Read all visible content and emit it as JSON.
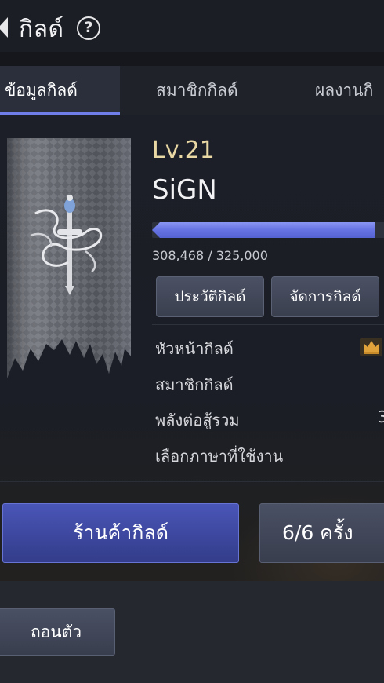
{
  "header": {
    "title": "กิลด์",
    "help_icon": "?"
  },
  "tabs": [
    {
      "label": "ข้อมูลกิลด์",
      "active": true
    },
    {
      "label": "สมาชิกกิลด์",
      "active": false
    },
    {
      "label": "ผลงานกิ",
      "active": false
    }
  ],
  "guild": {
    "level": "Lv.21",
    "name": "SiGN",
    "xp_text": "308,468 / 325,000",
    "xp_current": 308468,
    "xp_max": 325000,
    "emblem": "sword-emblem-banner"
  },
  "actions": {
    "history_label": "ประวัติกิลด์",
    "manage_label": "จัดการกิลด์"
  },
  "info": {
    "leader_label": "หัวหน้ากิลด์",
    "members_label": "สมาชิกกิลด์",
    "power_label": "พลังต่อสู้รวม",
    "power_value": "3",
    "language_label": "เลือกภาษาที่ใช้งาน"
  },
  "bottom": {
    "shop_label": "ร้านค้ากิลด์",
    "count_label": "6/6 ครั้ง",
    "leave_label": "ถอนตัว"
  },
  "colors": {
    "accent": "#6f7ee8",
    "level_gold": "#e9d7a4",
    "xp_fill": "#6573e3",
    "crown": "#e0a23a"
  }
}
